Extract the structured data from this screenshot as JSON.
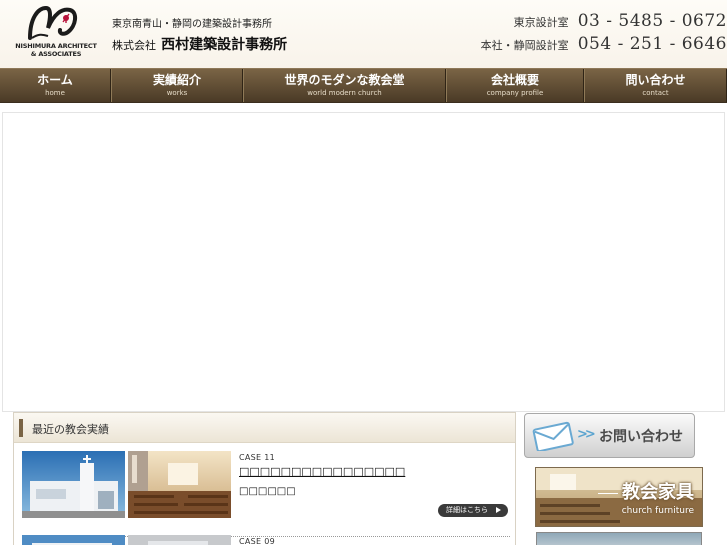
{
  "header": {
    "logo_line1": "NISHIMURA ARCHITECT",
    "logo_line2": "& ASSOCIATES",
    "tagline": "東京南青山・静岡の建築設計事務所",
    "company_prefix": "株式会社",
    "company_name": "西村建築設計事務所",
    "phones": [
      {
        "label": "東京設計室",
        "number": "03 - 5485 - 0672"
      },
      {
        "label": "本社・静岡設計室",
        "number": "054 - 251 - 6646"
      }
    ]
  },
  "nav": [
    {
      "jp": "ホーム",
      "en": "home"
    },
    {
      "jp": "実績紹介",
      "en": "works"
    },
    {
      "jp": "世界のモダンな教会堂",
      "en": "world modern church"
    },
    {
      "jp": "会社概要",
      "en": "company profile"
    },
    {
      "jp": "問い合わせ",
      "en": "contact"
    }
  ],
  "works": {
    "title": "最近の教会実績",
    "cases": [
      {
        "no": "CASE 11",
        "title": "□□□□□□□□□□□□□□□□",
        "place": "□□□□□□",
        "detail_label": "詳細はこちら"
      },
      {
        "no": "CASE 09"
      }
    ]
  },
  "sidebar": {
    "contact_label": "お問い合わせ",
    "furniture_jp": "教会家具",
    "furniture_en": "church furniture"
  },
  "colors": {
    "nav_bg": "#5a4731",
    "accent_blue": "#5ba4cf",
    "detail_button": "#3a3a3a"
  }
}
